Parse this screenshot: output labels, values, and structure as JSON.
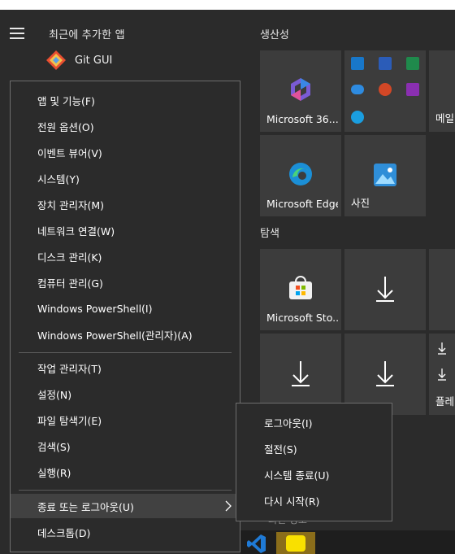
{
  "start_menu": {
    "recent_header": "최근에 추가한 앱",
    "recent_apps": [
      {
        "name": "Git GUI",
        "icon": "git-gui-icon"
      }
    ],
    "groups": [
      {
        "title": "생산성"
      },
      {
        "title": "탐색"
      }
    ],
    "tiles": {
      "microsoft365": "Microsoft 36...",
      "mail": "메일",
      "edge": "Microsoft Edge",
      "photos": "사진",
      "store": "Microsoft Sto...",
      "play": "플레"
    },
    "peek_text": "최신 정보"
  },
  "context_menu": {
    "items": [
      "앱 및 기능(F)",
      "전원 옵션(O)",
      "이벤트 뷰어(V)",
      "시스템(Y)",
      "장치 관리자(M)",
      "네트워크 연결(W)",
      "디스크 관리(K)",
      "컴퓨터 관리(G)",
      "Windows PowerShell(I)",
      "Windows PowerShell(관리자)(A)"
    ],
    "items2": [
      "작업 관리자(T)",
      "설정(N)",
      "파일 탐색기(E)",
      "검색(S)",
      "실행(R)"
    ],
    "shutdown": "종료 또는 로그아웃(U)",
    "desktop": "데스크톱(D)"
  },
  "submenu": {
    "items": [
      "로그아웃(I)",
      "절전(S)",
      "시스템 종료(U)",
      "다시 시작(R)"
    ]
  },
  "colors": {
    "background": "#2b2b2b",
    "tile": "#3c3c3c",
    "highlight": "#414141",
    "border": "#6e6e6e"
  }
}
